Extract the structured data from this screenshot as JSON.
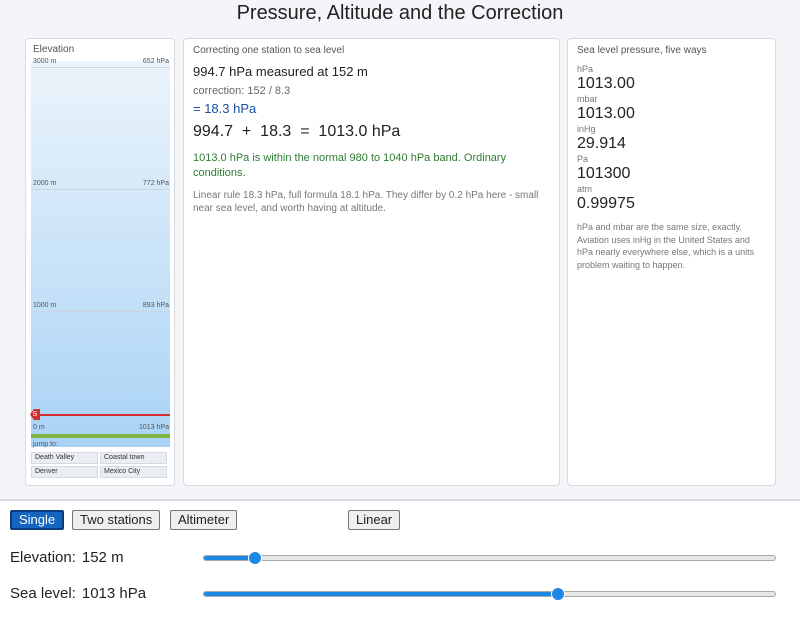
{
  "title": "Pressure, Altitude and the Correction",
  "elevation_panel": {
    "title": "Elevation",
    "ticks": [
      {
        "m": "3000 m",
        "p": "652 hPa"
      },
      {
        "m": "2000 m",
        "p": "772 hPa"
      },
      {
        "m": "1000 m",
        "p": "893 hPa"
      },
      {
        "m": "0 m",
        "p": "1013 hPa"
      }
    ],
    "marker_glyph": "S",
    "jump_label": "jump to:",
    "jump_buttons": [
      "Death Valley",
      "Coastal town",
      "Denver",
      "Mexico City"
    ]
  },
  "correction_panel": {
    "title": "Correcting one station to sea level",
    "measured": "994.7 hPa measured at 152 m",
    "formula": "correction: 152 / 8.3",
    "result": "= 18.3 hPa",
    "equation": "994.7  +  18.3  =  1013.0 hPa",
    "status_note": "1013.0 hPa is within the normal 980 to 1040 hPa band. Ordinary conditions.",
    "compare_note": "Linear rule 18.3 hPa, full formula 18.1 hPa. They differ by 0.2 hPa here - small near sea level, and worth having at altitude."
  },
  "units_panel": {
    "title": "Sea level pressure, five ways",
    "units": [
      {
        "label": "hPa",
        "value": "1013.00"
      },
      {
        "label": "mbar",
        "value": "1013.00"
      },
      {
        "label": "inHg",
        "value": "29.914"
      },
      {
        "label": "Pa",
        "value": "101300"
      },
      {
        "label": "atm",
        "value": "0.99975"
      }
    ],
    "note": "hPa and mbar are the same size, exactly. Aviation uses inHg in the United States and hPa nearly everywhere else, which is a units problem waiting to happen."
  },
  "controls": {
    "modes": [
      "Single",
      "Two stations",
      "Altimeter"
    ],
    "active_mode": "Single",
    "toggle_label": "Linear",
    "elevation": {
      "label": "Elevation:",
      "value": "152 m",
      "fraction": 0.09
    },
    "sea_level": {
      "label": "Sea level:",
      "value": "1013 hPa",
      "fraction": 0.62
    }
  },
  "colors": {
    "accent": "#1565c0",
    "slider": "#1e88e5",
    "marker": "#d32f2f",
    "ground": "#7cb342",
    "ok_text": "#2e7d32",
    "result_text": "#1a4fa0"
  }
}
